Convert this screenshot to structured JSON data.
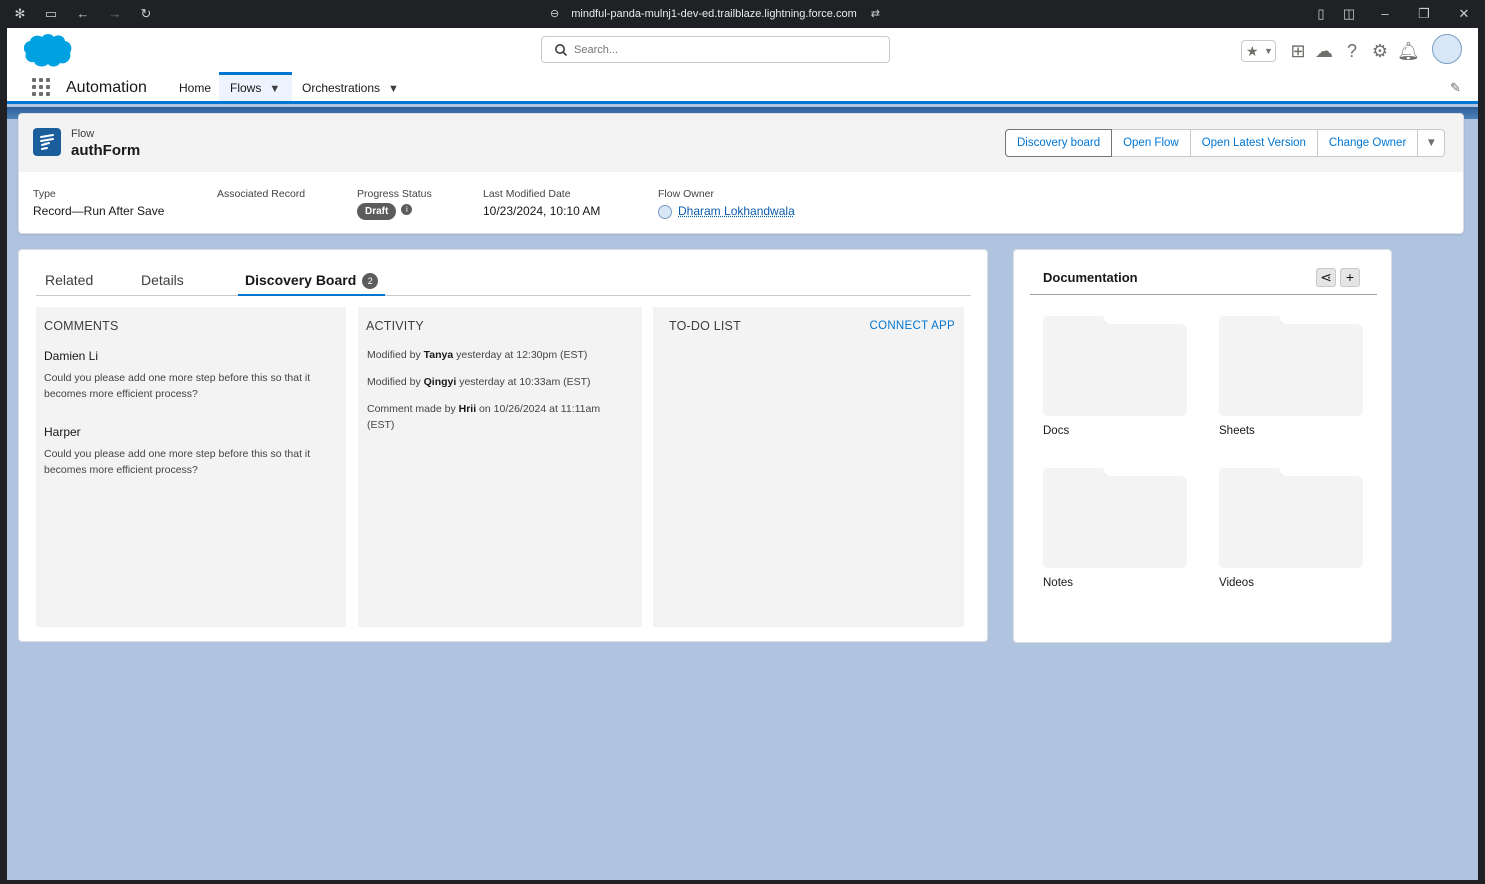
{
  "browser": {
    "url": "mindful-panda-mulnj1-dev-ed.trailblaze.lightning.force.com"
  },
  "header": {
    "search_placeholder": "Search..."
  },
  "appnav": {
    "app_name": "Automation",
    "items": [
      {
        "label": "Home"
      },
      {
        "label": "Flows"
      },
      {
        "label": "Orchestrations"
      }
    ]
  },
  "record": {
    "type_label": "Flow",
    "name": "authForm",
    "actions": [
      "Discovery board",
      "Open Flow",
      "Open Latest Version",
      "Change Owner"
    ],
    "fields": {
      "type": {
        "label": "Type",
        "value": "Record—Run After Save"
      },
      "associated": {
        "label": "Associated Record",
        "value": ""
      },
      "progress": {
        "label": "Progress Status",
        "value": "Draft"
      },
      "modified": {
        "label": "Last Modified Date",
        "value": "10/23/2024, 10:10 AM"
      },
      "owner": {
        "label": "Flow Owner",
        "value": "Dharam Lokhandwala"
      }
    }
  },
  "tabs": {
    "related": "Related",
    "details": "Details",
    "discovery": "Discovery Board",
    "discovery_count": "2"
  },
  "comments": {
    "title": "COMMENTS",
    "items": [
      {
        "author": "Damien Li",
        "text": "Could you please add one more step before this so that it becomes more efficient process?"
      },
      {
        "author": "Harper",
        "text": "Could you please add one more step before this so that it becomes more efficient process?"
      }
    ]
  },
  "activity": {
    "title": "ACTIVITY",
    "items": [
      {
        "prefix": "Modified by ",
        "name": "Tanya",
        "suffix": " yesterday at 12:30pm (EST)"
      },
      {
        "prefix": "Modified by ",
        "name": "Qingyi",
        "suffix": " yesterday at 10:33am (EST)"
      },
      {
        "prefix": "Comment made by ",
        "name": "Hrii",
        "suffix": " on 10/26/2024 at 11:11am (EST)"
      }
    ]
  },
  "todo": {
    "title": "TO-DO LIST",
    "connect": "CONNECT APP"
  },
  "documentation": {
    "title": "Documentation",
    "folders": [
      "Docs",
      "Sheets",
      "Notes",
      "Videos"
    ]
  },
  "colors": {
    "brand": "#0176d3",
    "background": "#b0c4df"
  }
}
